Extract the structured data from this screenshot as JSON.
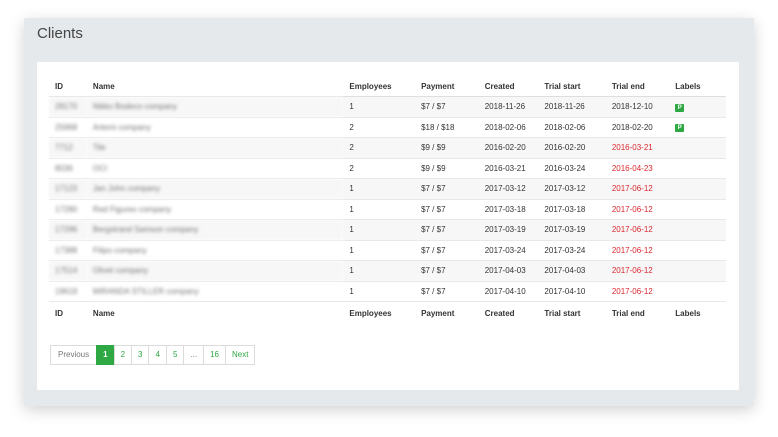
{
  "page": {
    "title": "Clients"
  },
  "table": {
    "columns": [
      "ID",
      "Name",
      "Employees",
      "Payment",
      "Created",
      "Trial start",
      "Trial end",
      "Labels"
    ],
    "rows": [
      {
        "id": "28170",
        "name": "Nikko Bodeco company",
        "employees": "1",
        "payment": "$7 / $7",
        "created": "2018-11-26",
        "trial_start": "2018-11-26",
        "trial_end": "2018-12-10",
        "trial_end_expired": false,
        "label": "P"
      },
      {
        "id": "25968",
        "name": "Artemi company",
        "employees": "2",
        "payment": "$18 / $18",
        "created": "2018-02-06",
        "trial_start": "2018-02-06",
        "trial_end": "2018-02-20",
        "trial_end_expired": false,
        "label": "P"
      },
      {
        "id": "7712",
        "name": "Tile",
        "employees": "2",
        "payment": "$9 / $9",
        "created": "2016-02-20",
        "trial_start": "2016-02-20",
        "trial_end": "2016-03-21",
        "trial_end_expired": true,
        "label": ""
      },
      {
        "id": "8036",
        "name": "OCI",
        "employees": "2",
        "payment": "$9 / $9",
        "created": "2016-03-21",
        "trial_start": "2016-03-24",
        "trial_end": "2016-04-23",
        "trial_end_expired": true,
        "label": ""
      },
      {
        "id": "17123",
        "name": "Jan John company",
        "employees": "1",
        "payment": "$7 / $7",
        "created": "2017-03-12",
        "trial_start": "2017-03-12",
        "trial_end": "2017-06-12",
        "trial_end_expired": true,
        "label": ""
      },
      {
        "id": "17280",
        "name": "Red Figures company",
        "employees": "1",
        "payment": "$7 / $7",
        "created": "2017-03-18",
        "trial_start": "2017-03-18",
        "trial_end": "2017-06-12",
        "trial_end_expired": true,
        "label": ""
      },
      {
        "id": "17296",
        "name": "Bergstrand Samson company",
        "employees": "1",
        "payment": "$7 / $7",
        "created": "2017-03-19",
        "trial_start": "2017-03-19",
        "trial_end": "2017-06-12",
        "trial_end_expired": true,
        "label": ""
      },
      {
        "id": "17388",
        "name": "Filipo company",
        "employees": "1",
        "payment": "$7 / $7",
        "created": "2017-03-24",
        "trial_start": "2017-03-24",
        "trial_end": "2017-06-12",
        "trial_end_expired": true,
        "label": ""
      },
      {
        "id": "17514",
        "name": "Olivet company",
        "employees": "1",
        "payment": "$7 / $7",
        "created": "2017-04-03",
        "trial_start": "2017-04-03",
        "trial_end": "2017-06-12",
        "trial_end_expired": true,
        "label": ""
      },
      {
        "id": "19619",
        "name": "MIRANDA STILLER company",
        "employees": "1",
        "payment": "$7 / $7",
        "created": "2017-04-10",
        "trial_start": "2017-04-10",
        "trial_end": "2017-06-12",
        "trial_end_expired": true,
        "label": ""
      }
    ]
  },
  "pagination": {
    "previous_label": "Previous",
    "pages": [
      "1",
      "2",
      "3",
      "4",
      "5",
      "...",
      "16"
    ],
    "current": "1",
    "next_label": "Next"
  },
  "colors": {
    "accent": "#2ea843",
    "expired": "#d9282f"
  }
}
